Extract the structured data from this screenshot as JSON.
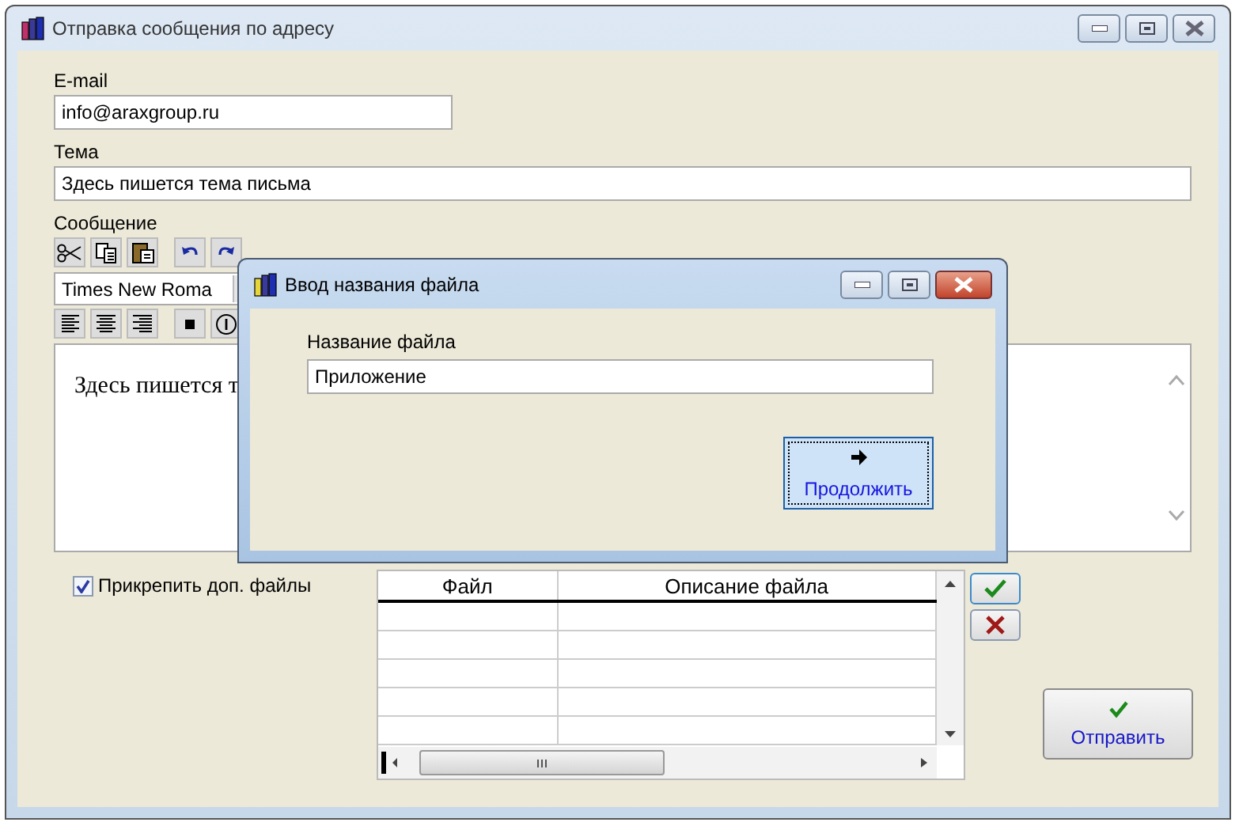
{
  "window": {
    "title": "Отправка сообщения по адресу"
  },
  "email": {
    "label": "E-mail",
    "value": "info@araxgroup.ru"
  },
  "subject": {
    "label": "Тема",
    "value": "Здесь пишется тема письма"
  },
  "message": {
    "label": "Сообщение",
    "font": "Times New Roma",
    "text": "Здесь пишется т"
  },
  "attach": {
    "label": "Прикрепить доп. файлы",
    "checked": true
  },
  "files_table": {
    "columns": [
      "Файл",
      "Описание файла"
    ]
  },
  "send_button": {
    "label": "Отправить"
  },
  "dialog": {
    "title": "Ввод названия файла",
    "field_label": "Название файла",
    "value": "Приложение",
    "button": "Продолжить"
  }
}
